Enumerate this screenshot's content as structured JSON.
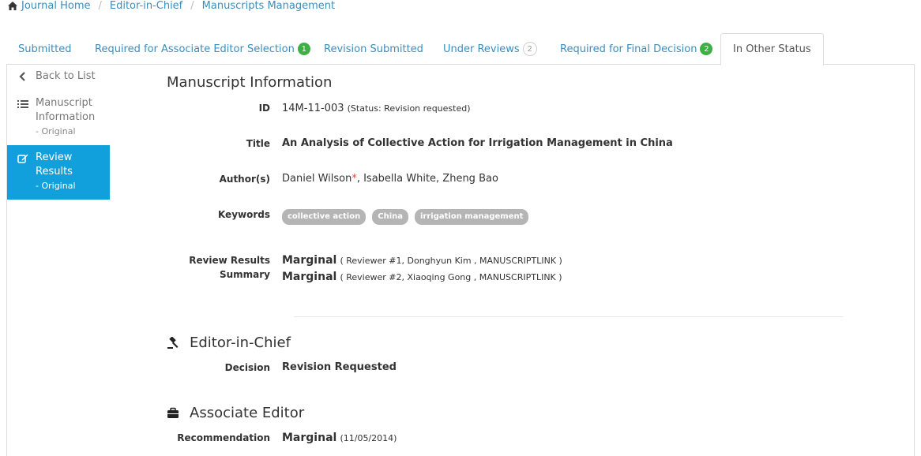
{
  "breadcrumb": {
    "items": [
      "Journal Home",
      "Editor-in-Chief",
      "Manuscripts Management"
    ],
    "separator": "/"
  },
  "tabs": [
    {
      "label": "Submitted",
      "badge": ""
    },
    {
      "label": "Required for Associate Editor Selection",
      "badge": "1"
    },
    {
      "label": "Revision Submitted",
      "badge": ""
    },
    {
      "label": "Under Reviews",
      "badge": "2"
    },
    {
      "label": "Required for Final Decision",
      "badge": "2"
    },
    {
      "label": "In Other Status",
      "badge": ""
    }
  ],
  "sidebar": {
    "back": "Back to List",
    "manuscript_info_line1": "Manuscript",
    "manuscript_info_line2": "Information",
    "manuscript_info_sub": "- Original",
    "review_results_line1": "Review",
    "review_results_line2": "Results",
    "review_results_sub": "- Original"
  },
  "manuscript": {
    "heading": "Manuscript Information",
    "id_label": "ID",
    "id_value": "14M-11-003",
    "id_status": "(Status: Revision requested)",
    "title_label": "Title",
    "title_value": "An Analysis of Collective Action for Irrigation Management in China",
    "authors_label": "Author(s)",
    "author_primary": "Daniel Wilson",
    "author_marker": "*",
    "authors_rest": ", Isabella White, Zheng Bao",
    "keywords_label": "Keywords",
    "keywords": [
      "collective action",
      "China",
      "irrigation management"
    ],
    "review_label_line1": "Review Results",
    "review_label_line2": "Summary",
    "reviews": [
      {
        "result": "Marginal",
        "detail": "( Reviewer #1, Donghyun Kim , MANUSCRIPTLINK )"
      },
      {
        "result": "Marginal",
        "detail": "( Reviewer #2, Xiaoqing Gong , MANUSCRIPTLINK )"
      }
    ]
  },
  "editor_in_chief": {
    "heading": "Editor-in-Chief",
    "decision_label": "Decision",
    "decision_value": "Revision Requested"
  },
  "associate_editor": {
    "heading": "Associate Editor",
    "recommendation_label": "Recommendation",
    "recommendation_value": "Marginal",
    "recommendation_date": "(11/05/2014)"
  },
  "colors": {
    "link": "#3c8dbc",
    "active_sidebar": "#12a0dd",
    "badge_green": "#3cb043",
    "tag_gray": "#b5b5b5",
    "required_star": "#dd4b39"
  },
  "icons": [
    "home-icon",
    "chevron-left-icon",
    "list-icon",
    "edit-icon",
    "gavel-icon",
    "briefcase-icon"
  ]
}
